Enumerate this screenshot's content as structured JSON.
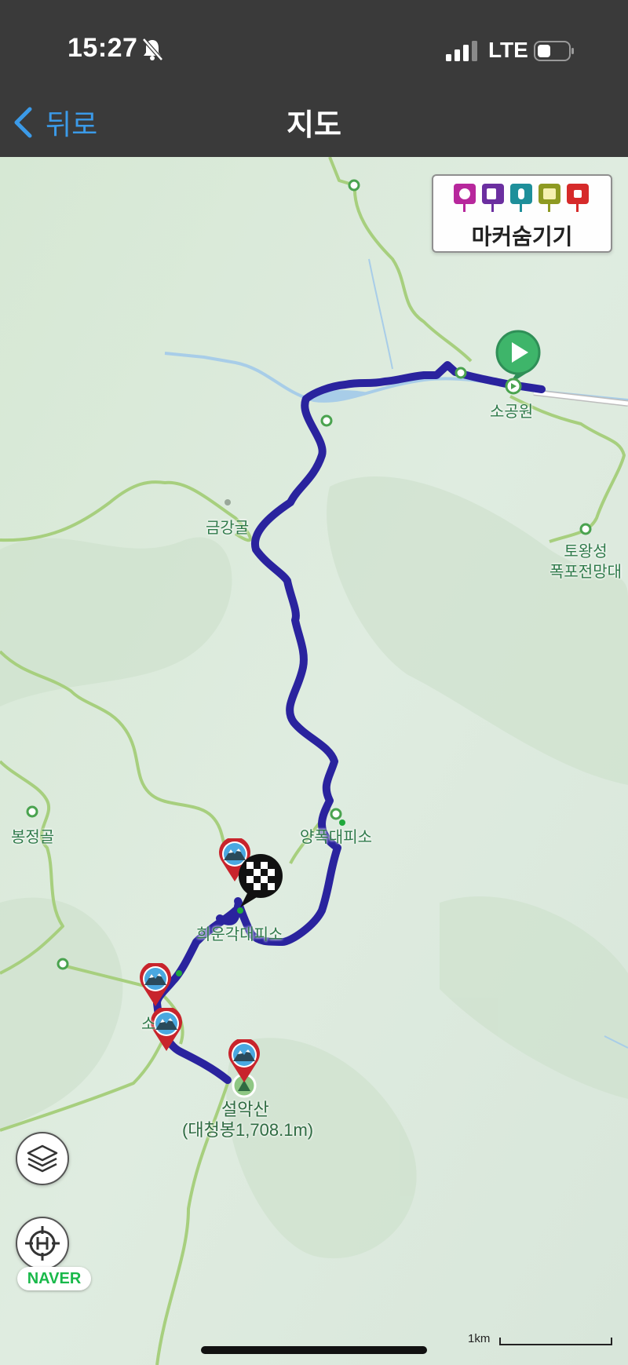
{
  "status": {
    "time": "15:27",
    "network": "LTE"
  },
  "nav": {
    "back_label": "뒤로",
    "title": "지도"
  },
  "marker_panel": {
    "label": "마커숨기기",
    "icons": [
      {
        "name": "camera-icon",
        "color": "#b7279c"
      },
      {
        "name": "video-icon",
        "color": "#6b2fa0"
      },
      {
        "name": "voice-icon",
        "color": "#1e8f9a"
      },
      {
        "name": "memo-icon",
        "color": "#8e9a22"
      },
      {
        "name": "flag-icon",
        "color": "#d62a2a"
      }
    ]
  },
  "places": {
    "sogongwon": "소공원",
    "geumganggul": "금강굴",
    "towangseong": "토왕성\n폭포전망대",
    "bongjeonggol": "봉정골",
    "yangpok": "양폭대피소",
    "huiungak": "희운각대피소",
    "partial": "소",
    "seoraksan": "설악산",
    "daecheongbong": "(대청봉1,708.1m)"
  },
  "map_controls": {
    "brand": "NAVER",
    "scale_label": "1km"
  },
  "colors": {
    "route": "#2a239e",
    "map_bg": "#dce9dc",
    "trail": "#a7cf7e",
    "river": "#a8cde8"
  }
}
